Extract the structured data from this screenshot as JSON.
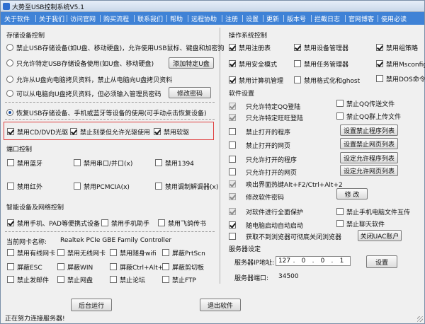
{
  "window": {
    "title": "大势至USB控制系统V5.1"
  },
  "menu": [
    "关于软件",
    "关于我们",
    "访问官网",
    "购买流程",
    "联系我们",
    "帮助",
    "远程协助",
    "注册",
    "设置",
    "更新",
    "版本号",
    "拦截日志",
    "官网博客",
    "使用必读"
  ],
  "storage": {
    "section": "存储设备控制",
    "radios": [
      {
        "label": "禁止USB存储设备(如U盘、移动硬盘)，允许使用USB鼠标、键盘和加密狗",
        "checked": false
      },
      {
        "label": "只允许特定USB存储设备使用(如U盘、移动硬盘)",
        "checked": false
      },
      {
        "label": "允许从U盘向电脑拷贝资料，禁止从电脑向U盘拷贝资料",
        "checked": false
      },
      {
        "label": "可以从电脑向U盘拷贝资料，但必须输入管理员密码",
        "checked": false
      },
      {
        "label": "恢复USB存储设备、手机或蓝牙等设备的使用(可手动点击恢复设备)",
        "checked": true
      }
    ],
    "add_device_button": "添加特定U盘",
    "change_password_button": "修改密码",
    "optical": [
      {
        "label": "禁用CD/DVD光驱",
        "checked": true
      },
      {
        "label": "禁止刻录但允许光驱使用",
        "checked": true
      },
      {
        "label": "禁用软驱",
        "checked": true
      }
    ]
  },
  "port": {
    "section": "端口控制",
    "items": [
      {
        "label": "禁用蓝牙",
        "checked": false
      },
      {
        "label": "禁用串口/并口(x)",
        "checked": false
      },
      {
        "label": "禁用1394",
        "checked": false
      },
      {
        "label": "禁用红外",
        "checked": false
      },
      {
        "label": "禁用PCMCIA(x)",
        "checked": false
      },
      {
        "label": "禁用调制解调器(x)",
        "checked": false
      }
    ]
  },
  "smart": {
    "section": "智能设备及网络控制",
    "items": [
      {
        "label": "禁用手机、PAD等便携式设备",
        "checked": true
      },
      {
        "label": "禁用手机助手",
        "checked": false
      },
      {
        "label": "禁用飞鸽传书",
        "checked": false
      }
    ],
    "nic_label": "当前网卡名称:",
    "nic_value": "Realtek PCIe GBE Family Controller",
    "grid": [
      {
        "label": "禁用有线网卡",
        "checked": false
      },
      {
        "label": "禁用无线网卡",
        "checked": false
      },
      {
        "label": "禁用随身wifi",
        "checked": false
      },
      {
        "label": "屏蔽PrtScn",
        "checked": false
      },
      {
        "label": "屏蔽ESC",
        "checked": false
      },
      {
        "label": "屏蔽WIN",
        "checked": false
      },
      {
        "label": "屏蔽Ctrl+Alt+A",
        "checked": false
      },
      {
        "label": "屏蔽剪切板",
        "checked": false
      },
      {
        "label": "禁止发邮件",
        "checked": false
      },
      {
        "label": "禁止网盘",
        "checked": false
      },
      {
        "label": "禁止论坛",
        "checked": false
      },
      {
        "label": "禁止FTP",
        "checked": false
      }
    ]
  },
  "os": {
    "section": "操作系统控制",
    "items": [
      {
        "label": "禁用注册表",
        "checked": true
      },
      {
        "label": "禁用设备管理器",
        "checked": true
      },
      {
        "label": "禁用组策略",
        "checked": true
      },
      {
        "label": "禁用安全模式",
        "checked": true
      },
      {
        "label": "禁用任务管理器",
        "checked": false
      },
      {
        "label": "禁用Msconfig",
        "checked": true
      },
      {
        "label": "禁用计算机管理",
        "checked": true
      },
      {
        "label": "禁用格式化和ghost",
        "checked": false
      },
      {
        "label": "禁用DOS命令",
        "checked": false
      }
    ]
  },
  "software": {
    "section": "软件设置",
    "rows": [
      {
        "label": "只允许特定QQ登陆",
        "checked": true,
        "disabled": true
      },
      {
        "label": "禁止QQ传送文件",
        "checked": false,
        "disabled": false
      },
      {
        "label": "只允许特定旺旺登陆",
        "checked": true,
        "disabled": true
      },
      {
        "label": "禁止QQ群上传文件",
        "checked": false,
        "disabled": false
      },
      {
        "label": "禁止打开的程序",
        "checked": false,
        "disabled": false
      },
      {
        "label": "禁止打开的网页",
        "checked": false,
        "disabled": false
      },
      {
        "label": "只允许打开的程序",
        "checked": false,
        "disabled": false
      },
      {
        "label": "只允许打开的网页",
        "checked": false,
        "disabled": false
      },
      {
        "label": "唤出界面热键Alt+F2/Ctrl+Alt+2",
        "checked": true,
        "disabled": true
      },
      {
        "label": "修改软件密码",
        "checked": true,
        "disabled": true
      },
      {
        "label": "对软件进行全面保护",
        "checked": true,
        "disabled": true
      },
      {
        "label": "禁止手机电脑文件互传",
        "checked": false,
        "disabled": false
      },
      {
        "label": "随电脑启动自动启动",
        "checked": true,
        "disabled": false
      },
      {
        "label": "禁止聊天软件",
        "checked": false,
        "disabled": false
      },
      {
        "label": "获取不到浏览器可彻底关闭浏览器",
        "checked": false,
        "disabled": false
      }
    ],
    "buttons": {
      "block_program": "设置禁止程序列表",
      "block_web": "设置禁止网页列表",
      "allow_program": "设定允许程序列表",
      "allow_web": "设定允许网页列表",
      "modify": "修 改",
      "set": "设置",
      "close_uac": "关闭UAC账户"
    }
  },
  "server": {
    "section": "服务器设定",
    "ip_label": "服务器IP地址:",
    "ip": [
      "127",
      "0",
      "0",
      "1"
    ],
    "port_label": "服务器端口:",
    "port": "34500",
    "set_button": "设置"
  },
  "footer": {
    "run_background": "后台运行",
    "exit": "退出软件",
    "status": "正在努力连接服务器!"
  }
}
